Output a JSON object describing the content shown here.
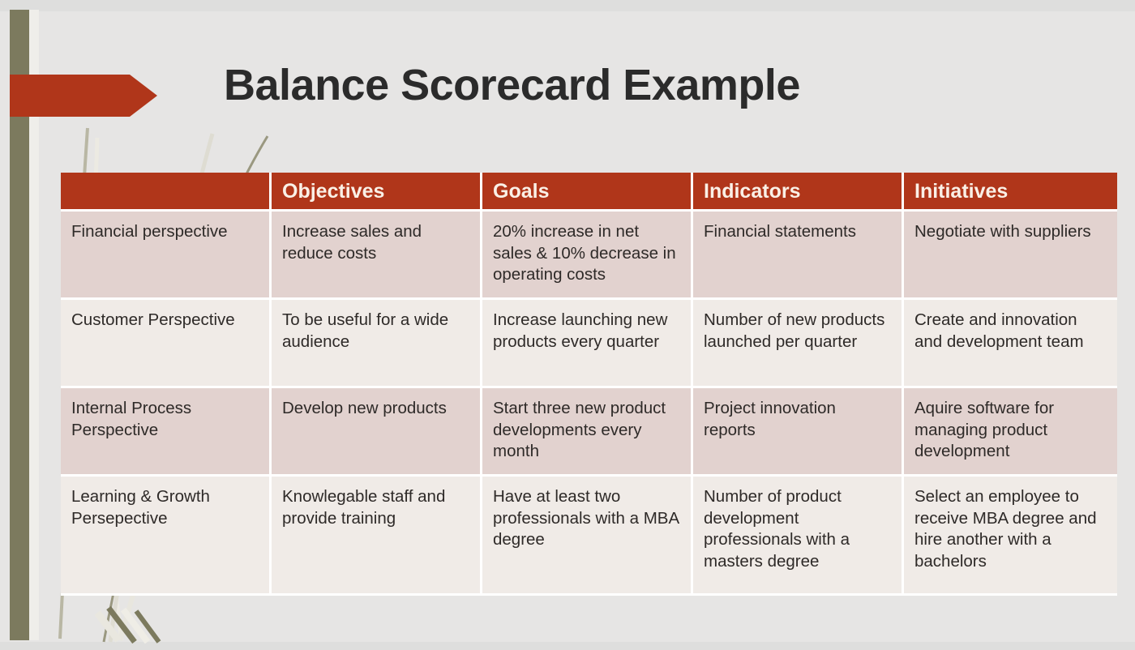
{
  "slide": {
    "title": "Balance Scorecard Example",
    "background_color": "#E6E5E4",
    "accent_color": "#B0361A",
    "olive_color": "#7C7A5E",
    "row_tint_dark": "#E2D2CF",
    "row_tint_light": "#F0EBE7",
    "header_text_color": "#FAF0E6"
  },
  "table": {
    "headers": [
      "",
      "Objectives",
      "Goals",
      "Indicators",
      "Initiatives"
    ],
    "rows": [
      {
        "perspective": "Financial perspective",
        "objectives": "Increase sales and reduce costs",
        "goals": "20% increase in net sales & 10% decrease in operating costs",
        "indicators": "Financial statements",
        "initiatives": "Negotiate with suppliers"
      },
      {
        "perspective": "Customer Perspective",
        "objectives": "To be useful for a wide audience",
        "goals": "Increase launching new products every quarter",
        "indicators": "Number of new products launched per quarter",
        "initiatives": "Create and innovation and development team"
      },
      {
        "perspective": "Internal Process Perspective",
        "objectives": "Develop new products",
        "goals": "Start three new product developments every month",
        "indicators": "Project innovation reports",
        "initiatives": "Aquire software for managing product development"
      },
      {
        "perspective": "Learning & Growth Persepective",
        "objectives": "Knowlegable staff and provide training",
        "goals": "Have at least two professionals with a MBA degree",
        "indicators": "Number of product development professionals with a masters degree",
        "initiatives": "Select an employee to receive MBA degree and hire another with a bachelors"
      }
    ]
  },
  "decoration": {
    "arrow_icon": "right-arrow-banner",
    "grass_icon": "grass-blades",
    "bar_icon": "vertical-olive-bar"
  }
}
